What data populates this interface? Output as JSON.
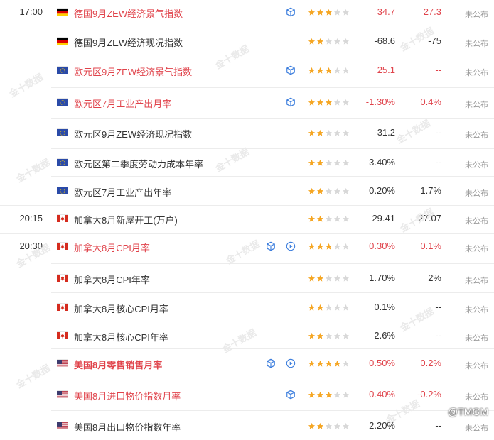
{
  "colors": {
    "red": "#e0434b",
    "star_on": "#f5a623",
    "star_off": "#d8d8d8",
    "status": "#999999"
  },
  "watermark": "金十数据",
  "brand": "@TMGM",
  "rows": [
    {
      "time": "17:00",
      "country": "de",
      "title": "德国9月ZEW经济景气指数",
      "hot": true,
      "bold": false,
      "icons": [
        "cube"
      ],
      "stars": 3,
      "prev": "34.7",
      "prev_red": true,
      "forecast": "27.3",
      "forecast_red": true,
      "actual": "未公布"
    },
    {
      "time": "",
      "country": "de",
      "title": "德国9月ZEW经济现况指数",
      "hot": false,
      "bold": false,
      "icons": [],
      "stars": 2,
      "prev": "-68.6",
      "prev_red": false,
      "forecast": "-75",
      "forecast_red": false,
      "actual": "未公布"
    },
    {
      "time": "",
      "country": "eu",
      "title": "欧元区9月ZEW经济景气指数",
      "hot": true,
      "bold": false,
      "icons": [
        "cube"
      ],
      "stars": 3,
      "prev": "25.1",
      "prev_red": true,
      "forecast": "--",
      "forecast_red": true,
      "actual": "未公布"
    },
    {
      "time": "",
      "country": "eu",
      "title": "欧元区7月工业产出月率",
      "hot": true,
      "bold": false,
      "icons": [
        "cube"
      ],
      "stars": 3,
      "prev": "-1.30%",
      "prev_red": true,
      "forecast": "0.4%",
      "forecast_red": true,
      "actual": "未公布"
    },
    {
      "time": "",
      "country": "eu",
      "title": "欧元区9月ZEW经济现况指数",
      "hot": false,
      "bold": false,
      "icons": [],
      "stars": 2,
      "prev": "-31.2",
      "prev_red": false,
      "forecast": "--",
      "forecast_red": false,
      "actual": "未公布"
    },
    {
      "time": "",
      "country": "eu",
      "title": "欧元区第二季度劳动力成本年率",
      "hot": false,
      "bold": false,
      "icons": [],
      "stars": 2,
      "prev": "3.40%",
      "prev_red": false,
      "forecast": "--",
      "forecast_red": false,
      "actual": "未公布"
    },
    {
      "time": "",
      "country": "eu",
      "title": "欧元区7月工业产出年率",
      "hot": false,
      "bold": false,
      "icons": [],
      "stars": 2,
      "prev": "0.20%",
      "prev_red": false,
      "forecast": "1.7%",
      "forecast_red": false,
      "actual": "未公布"
    },
    {
      "time": "20:15",
      "country": "ca",
      "title": "加拿大8月新屋开工(万户)",
      "hot": false,
      "bold": false,
      "icons": [],
      "stars": 2,
      "prev": "29.41",
      "prev_red": false,
      "forecast": "27.07",
      "forecast_red": false,
      "actual": "未公布"
    },
    {
      "time": "20:30",
      "country": "ca",
      "title": "加拿大8月CPI月率",
      "hot": true,
      "bold": false,
      "icons": [
        "cube",
        "play"
      ],
      "stars": 3,
      "prev": "0.30%",
      "prev_red": true,
      "forecast": "0.1%",
      "forecast_red": true,
      "actual": "未公布"
    },
    {
      "time": "",
      "country": "ca",
      "title": "加拿大8月CPI年率",
      "hot": false,
      "bold": false,
      "icons": [],
      "stars": 2,
      "prev": "1.70%",
      "prev_red": false,
      "forecast": "2%",
      "forecast_red": false,
      "actual": "未公布"
    },
    {
      "time": "",
      "country": "ca",
      "title": "加拿大8月核心CPI月率",
      "hot": false,
      "bold": false,
      "icons": [],
      "stars": 2,
      "prev": "0.1%",
      "prev_red": false,
      "forecast": "--",
      "forecast_red": false,
      "actual": "未公布"
    },
    {
      "time": "",
      "country": "ca",
      "title": "加拿大8月核心CPI年率",
      "hot": false,
      "bold": false,
      "icons": [],
      "stars": 2,
      "prev": "2.6%",
      "prev_red": false,
      "forecast": "--",
      "forecast_red": false,
      "actual": "未公布"
    },
    {
      "time": "",
      "country": "us",
      "title": "美国8月零售销售月率",
      "hot": true,
      "bold": true,
      "icons": [
        "cube",
        "play"
      ],
      "stars": 4,
      "prev": "0.50%",
      "prev_red": true,
      "forecast": "0.2%",
      "forecast_red": true,
      "actual": "未公布"
    },
    {
      "time": "",
      "country": "us",
      "title": "美国8月进口物价指数月率",
      "hot": true,
      "bold": false,
      "icons": [
        "cube"
      ],
      "stars": 3,
      "prev": "0.40%",
      "prev_red": true,
      "forecast": "-0.2%",
      "forecast_red": true,
      "actual": "未公布"
    },
    {
      "time": "",
      "country": "us",
      "title": "美国8月出口物价指数年率",
      "hot": false,
      "bold": false,
      "icons": [],
      "stars": 2,
      "prev": "2.20%",
      "prev_red": false,
      "forecast": "--",
      "forecast_red": false,
      "actual": "未公布"
    }
  ]
}
